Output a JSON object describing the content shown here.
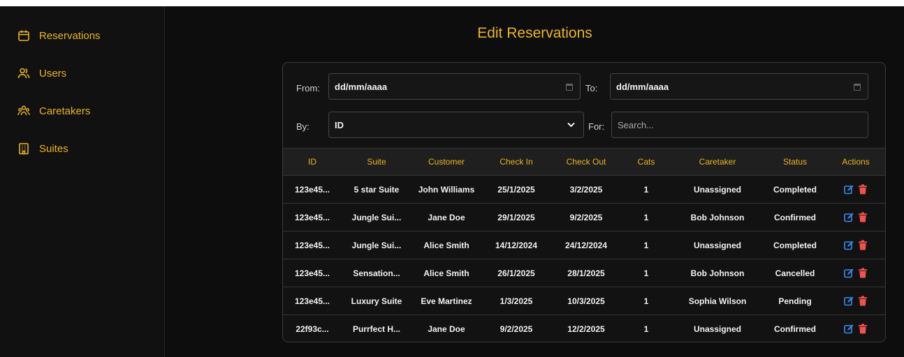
{
  "sidebar": {
    "items": [
      {
        "label": "Reservations",
        "icon": "calendar-icon"
      },
      {
        "label": "Users",
        "icon": "users-icon"
      },
      {
        "label": "Caretakers",
        "icon": "group-icon"
      },
      {
        "label": "Suites",
        "icon": "building-icon"
      }
    ]
  },
  "page": {
    "title": "Edit Reservations"
  },
  "filters": {
    "from_label": "From:",
    "from_value": "dd/mm/aaaa",
    "to_label": "To:",
    "to_value": "dd/mm/aaaa",
    "by_label": "By:",
    "by_value": "ID",
    "for_label": "For:",
    "search_placeholder": "Search..."
  },
  "table": {
    "headers": [
      "ID",
      "Suite",
      "Customer",
      "Check In",
      "Check Out",
      "Cats",
      "Caretaker",
      "Status",
      "Actions"
    ],
    "rows": [
      [
        "123e45...",
        "5 star Suite",
        "John Williams",
        "25/1/2025",
        "3/2/2025",
        "1",
        "Unassigned",
        "Completed"
      ],
      [
        "123e45...",
        "Jungle Sui...",
        "Jane Doe",
        "29/1/2025",
        "9/2/2025",
        "1",
        "Bob Johnson",
        "Confirmed"
      ],
      [
        "123e45...",
        "Jungle Sui...",
        "Alice Smith",
        "14/12/2024",
        "24/12/2024",
        "1",
        "Unassigned",
        "Completed"
      ],
      [
        "123e45...",
        "Sensation...",
        "Alice Smith",
        "26/1/2025",
        "28/1/2025",
        "1",
        "Bob Johnson",
        "Cancelled"
      ],
      [
        "123e45...",
        "Luxury Suite",
        "Eve Martinez",
        "1/3/2025",
        "10/3/2025",
        "1",
        "Sophia Wilson",
        "Pending"
      ],
      [
        "22f93c...",
        "Purrfect H...",
        "Jane Doe",
        "9/2/2025",
        "12/2/2025",
        "1",
        "Unassigned",
        "Confirmed"
      ]
    ]
  },
  "colors": {
    "accent": "#e8b520",
    "edit": "#3b8cf0",
    "delete": "#ef5350",
    "background": "#0d0d0d"
  }
}
